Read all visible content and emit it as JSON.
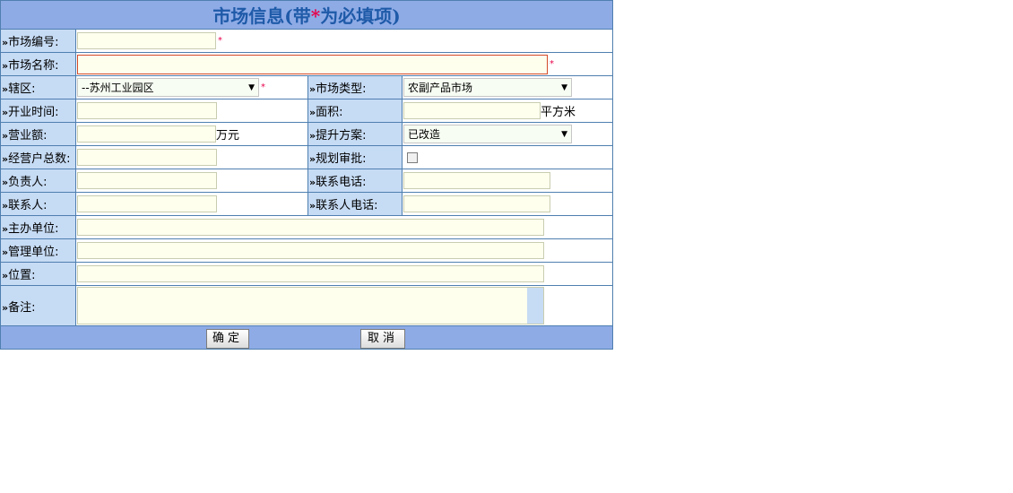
{
  "title": {
    "prefix": "市场信息(带",
    "star": "*",
    "suffix": "为必填项)"
  },
  "fields": {
    "market_no": {
      "label": "市场编号:",
      "value": "",
      "required": "*"
    },
    "market_name": {
      "label": "市场名称:",
      "value": "",
      "required": "*"
    },
    "district": {
      "label": "辖区:",
      "value": "--苏州工业园区",
      "required": "*"
    },
    "market_type": {
      "label": "市场类型:",
      "value": "农副产品市场"
    },
    "open_time": {
      "label": "开业时间:",
      "value": ""
    },
    "area": {
      "label": "面积:",
      "value": "",
      "unit": "平方米"
    },
    "turnover": {
      "label": "营业额:",
      "value": "",
      "unit": "万元"
    },
    "upgrade_plan": {
      "label": "提升方案:",
      "value": "已改造"
    },
    "merchant_count": {
      "label": "经营户总数:",
      "value": ""
    },
    "planning_approval": {
      "label": "规划审批:",
      "checked": false
    },
    "person_in_charge": {
      "label": "负责人:",
      "value": ""
    },
    "contact_phone": {
      "label": "联系电话:",
      "value": ""
    },
    "contact_person": {
      "label": "联系人:",
      "value": ""
    },
    "contact_person_phone": {
      "label": "联系人电话:",
      "value": ""
    },
    "sponsor_unit": {
      "label": "主办单位:",
      "value": ""
    },
    "management_unit": {
      "label": "管理单位:",
      "value": ""
    },
    "location": {
      "label": "位置:",
      "value": ""
    },
    "remarks": {
      "label": "备注:",
      "value": ""
    }
  },
  "label_prefix": "»",
  "buttons": {
    "confirm": "确定",
    "cancel": "取消"
  },
  "colors": {
    "header_bg": "#8eabe6",
    "label_bg": "#c6dbf4",
    "input_bg": "#ffffee",
    "required": "#e8004a",
    "title_text": "#1e5aa8"
  }
}
